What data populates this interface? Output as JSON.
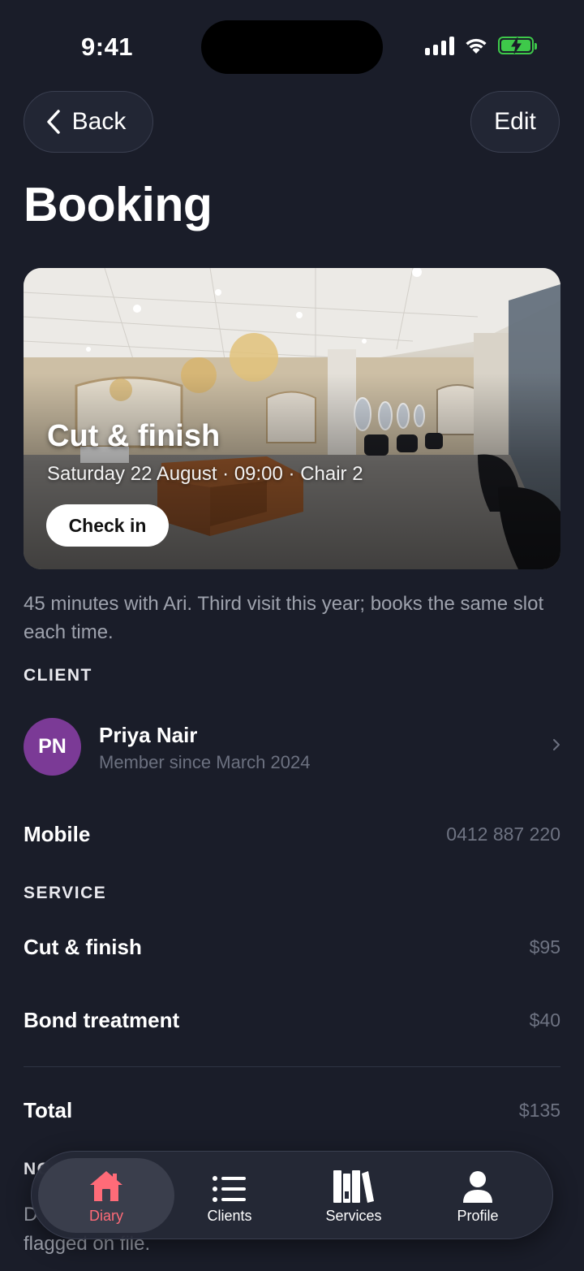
{
  "status": {
    "time": "9:41"
  },
  "nav": {
    "back_label": "Back",
    "edit_label": "Edit"
  },
  "page": {
    "title": "Booking"
  },
  "hero": {
    "title": "Cut & finish",
    "subtitle": "Saturday 22 August · 09:00 · Chair 2",
    "checkin_label": "Check in"
  },
  "description": "45 minutes with Ari. Third visit this year; books the same slot each time.",
  "client_section": {
    "label": "CLIENT",
    "initials": "PN",
    "name": "Priya Nair",
    "since": "Member since March 2024",
    "avatar_color": "#7b3a96",
    "mobile_label": "Mobile",
    "mobile_value": "0412 887 220"
  },
  "service_section": {
    "label": "SERVICE",
    "items": [
      {
        "name": "Cut & finish",
        "price": "$95"
      },
      {
        "name": "Bond treatment",
        "price": "$40"
      }
    ],
    "total_label": "Total",
    "total_value": "$135"
  },
  "notes_section": {
    "label": "NO",
    "text": "D                                                              ,\nflagged on file."
  },
  "tabbar": {
    "tabs": [
      {
        "label": "Diary",
        "icon": "house-icon",
        "active": true
      },
      {
        "label": "Clients",
        "icon": "list-icon",
        "active": false
      },
      {
        "label": "Services",
        "icon": "books-icon",
        "active": false
      },
      {
        "label": "Profile",
        "icon": "person-icon",
        "active": false
      }
    ],
    "active_color": "#ff6b78"
  }
}
